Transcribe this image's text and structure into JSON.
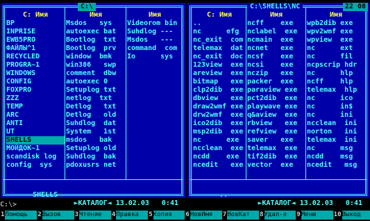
{
  "left_panel": {
    "title": "C:\\",
    "columns": [
      {
        "header": "C: Имя",
        "items": [
          "BP",
          "INPRISE",
          "EWB5PRO",
          "ФАЙЛЫ^1",
          "RECYCLED",
          "PROGRA~1",
          "WINDOWS",
          "CONFIG",
          "FOXPRO",
          "ZZZ",
          "TEMP",
          "ARC",
          "ANTI",
          "UT",
          "SHELLS",
          "МОЙДОК~1",
          "scandisk log",
          "config  sys"
        ]
      },
      {
        "header": "Имя",
        "items": [
          "Msdos   sys",
          "autoexec bat",
          "Bootlog  txt",
          "Bootlog  prv",
          "window  bmk",
          "win386   swp",
          "comment  dbw",
          "autoexec 0",
          "Setuplog txt",
          "netlog  txt",
          "Detlog   txt",
          "Detlog   old",
          "Suhdlog  dat",
          "System   1st",
          "msdos   bak",
          "Setuplog old",
          "Suhdlog  bak",
          "pdoxusrs net"
        ]
      },
      {
        "header": "Имя",
        "items": [
          "Videorom bin",
          "Suhdlog ---",
          "Msdos   ---",
          "command  com",
          "Io      sys",
          "",
          "",
          "",
          "",
          "",
          "",
          "",
          "",
          "",
          "",
          "",
          "",
          ""
        ]
      }
    ],
    "cursor_item": "SHELLS",
    "status_name": "SHELLS",
    "status_info": "►КАТАЛОГ◄ 13.02.03   0:41"
  },
  "right_panel": {
    "title": "C:\\SHELLS\\NC",
    "clock": "22 08",
    "columns": [
      {
        "header": "C: Имя",
        "items": [
          "..",
          "nc      efg",
          "nc_exit  com",
          "telemax  dat",
          "nc_exit  doc",
          "123view  exe",
          "areview  exe",
          "bitmap   exe",
          "clp2dib  exe",
          "dbview   exe",
          "draw2wmf exe",
          "drw2wmf  exe",
          "ico2dib  exe",
          "msp2dib  exe",
          "nc      exe",
          "ncclean  exe",
          "ncdd    exe",
          "ncedit   exe"
        ]
      },
      {
        "header": "Имя",
        "items": [
          "ncff    exe",
          "nclabel  exe",
          "ncmain  exe",
          "ncnet   exe",
          "ncsf    exe",
          "ncsi    exe",
          "nczip   exe",
          "packer  exe",
          "paraview exe",
          "pct2dib  exe",
          "playwave exe",
          "q&aview  exe",
          "rbview   exe",
          "refview  exe",
          "saver   exe",
          "telemax  exe",
          "tif2dib  exe",
          "vector  exe"
        ]
      },
      {
        "header": "Имя",
        "items": [
          "wpb2dib exe",
          "wpv2wmf exe",
          "wpview  exe",
          "nc      ext",
          "nc      fil",
          "ncpscrip hdr",
          "nc      hlp",
          "ncff    hlp",
          "telemax  hlp",
          "nc      ico",
          "nc      in$",
          "nc      ini",
          "ncclean  ini",
          "norton   ini",
          "telemax  ini",
          "nc      msg",
          "ncdd    msg",
          "ncedit   msg"
        ]
      }
    ],
    "status_name": "..",
    "status_info": "►КАТАЛОГ◄ 13.02.03   0:41"
  },
  "command_line": "C:\\>",
  "fkeys": [
    {
      "num": "1",
      "label": "Помощь"
    },
    {
      "num": "2",
      "label": "Вызов"
    },
    {
      "num": "3",
      "label": "Чтение"
    },
    {
      "num": "4",
      "label": "Правка"
    },
    {
      "num": "5",
      "label": "Копия"
    },
    {
      "num": "6",
      "label": "НовИмя"
    },
    {
      "num": "7",
      "label": "НовКат"
    },
    {
      "num": "8",
      "label": "Удал-е"
    },
    {
      "num": "9",
      "label": "Меню"
    },
    {
      "num": "10",
      "label": "Выход"
    }
  ],
  "colors": {
    "panel_bg": "#0000a8",
    "text": "#55ffff",
    "header": "#ffff55",
    "cursor_bg": "#00aaaa"
  }
}
